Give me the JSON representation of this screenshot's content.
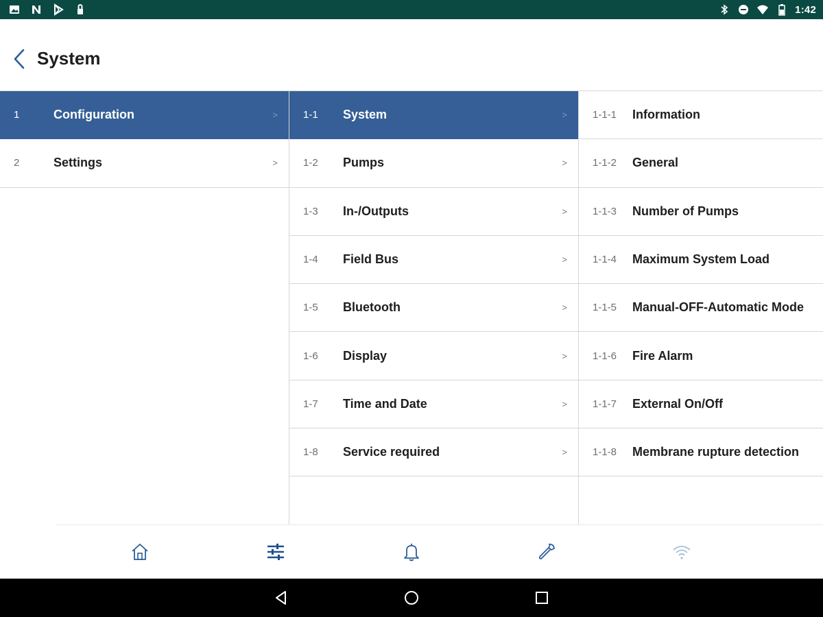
{
  "status_bar": {
    "left_icons": [
      "image-icon",
      "n-icon",
      "play-store-icon",
      "lock-icon"
    ],
    "right_icons": [
      "bluetooth-icon",
      "dnd-icon",
      "wifi-icon",
      "battery-icon"
    ],
    "time": "1:42"
  },
  "header": {
    "back_icon": "chevron-left-icon",
    "title": "System"
  },
  "columns": [
    {
      "rows": [
        {
          "num": "1",
          "label": "Configuration",
          "chevron": ">",
          "active": true
        },
        {
          "num": "2",
          "label": "Settings",
          "chevron": ">",
          "active": false
        }
      ]
    },
    {
      "rows": [
        {
          "num": "1-1",
          "label": "System",
          "chevron": ">",
          "active": true
        },
        {
          "num": "1-2",
          "label": "Pumps",
          "chevron": ">",
          "active": false
        },
        {
          "num": "1-3",
          "label": "In-/Outputs",
          "chevron": ">",
          "active": false
        },
        {
          "num": "1-4",
          "label": "Field Bus",
          "chevron": ">",
          "active": false
        },
        {
          "num": "1-5",
          "label": "Bluetooth",
          "chevron": ">",
          "active": false
        },
        {
          "num": "1-6",
          "label": "Display",
          "chevron": ">",
          "active": false
        },
        {
          "num": "1-7",
          "label": "Time and Date",
          "chevron": ">",
          "active": false
        },
        {
          "num": "1-8",
          "label": "Service required",
          "chevron": ">",
          "active": false
        }
      ]
    },
    {
      "rows": [
        {
          "num": "1-1-1",
          "label": "Information"
        },
        {
          "num": "1-1-2",
          "label": "General"
        },
        {
          "num": "1-1-3",
          "label": "Number of Pumps"
        },
        {
          "num": "1-1-4",
          "label": "Maximum System Load"
        },
        {
          "num": "1-1-5",
          "label": "Manual-OFF-Automatic Mode"
        },
        {
          "num": "1-1-6",
          "label": "Fire Alarm"
        },
        {
          "num": "1-1-7",
          "label": "External On/Off"
        },
        {
          "num": "1-1-8",
          "label": "Membrane rupture detection"
        }
      ]
    }
  ],
  "bottom_nav": {
    "items": [
      "home-icon",
      "settings-sliders-icon",
      "bell-icon",
      "wrench-icon",
      "wifi-icon"
    ],
    "active": "settings-sliders-icon"
  },
  "android_nav": {
    "items": [
      "back-triangle-icon",
      "home-circle-icon",
      "recents-square-icon"
    ]
  },
  "colors": {
    "status_bar": "#0b4a43",
    "active_row": "#355f96",
    "accent": "#2c5c9a"
  }
}
